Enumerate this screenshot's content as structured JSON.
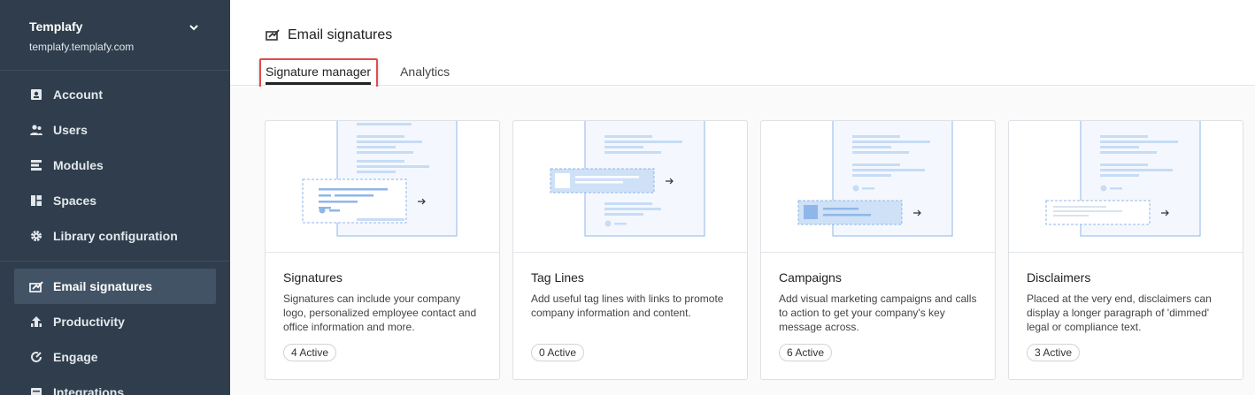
{
  "workspace": {
    "name": "Templafy",
    "domain": "templafy.templafy.com"
  },
  "sidebar": {
    "items": [
      {
        "label": "Account",
        "icon": "account-icon"
      },
      {
        "label": "Users",
        "icon": "users-icon"
      },
      {
        "label": "Modules",
        "icon": "modules-icon"
      },
      {
        "label": "Spaces",
        "icon": "spaces-icon"
      },
      {
        "label": "Library configuration",
        "icon": "gear-icon"
      },
      {
        "label": "Email signatures",
        "icon": "email-signature-icon",
        "active": true
      },
      {
        "label": "Productivity",
        "icon": "productivity-icon"
      },
      {
        "label": "Engage",
        "icon": "engage-icon"
      },
      {
        "label": "Integrations",
        "icon": "integrations-icon"
      }
    ]
  },
  "header": {
    "title": "Email signatures",
    "tabs": [
      {
        "label": "Signature manager",
        "active": true
      },
      {
        "label": "Analytics",
        "active": false
      }
    ]
  },
  "cards": [
    {
      "title": "Signatures",
      "description": "Signatures can include your company logo, personalized employee contact and office information and more.",
      "badge": "4 Active"
    },
    {
      "title": "Tag Lines",
      "description": "Add useful tag lines with links to promote company information and content.",
      "badge": "0 Active"
    },
    {
      "title": "Campaigns",
      "description": "Add visual marketing campaigns and calls to action to get your company's key message across.",
      "badge": "6 Active"
    },
    {
      "title": "Disclaimers",
      "description": "Placed at the very end, disclaimers can display a longer paragraph of 'dimmed' legal or compliance text.",
      "badge": "3 Active"
    }
  ],
  "colors": {
    "sidebar_bg": "#2f3d4c",
    "active_item_bg": "#425366",
    "highlight": "#e34b4b",
    "illus_blue": "#8fb6e8"
  }
}
